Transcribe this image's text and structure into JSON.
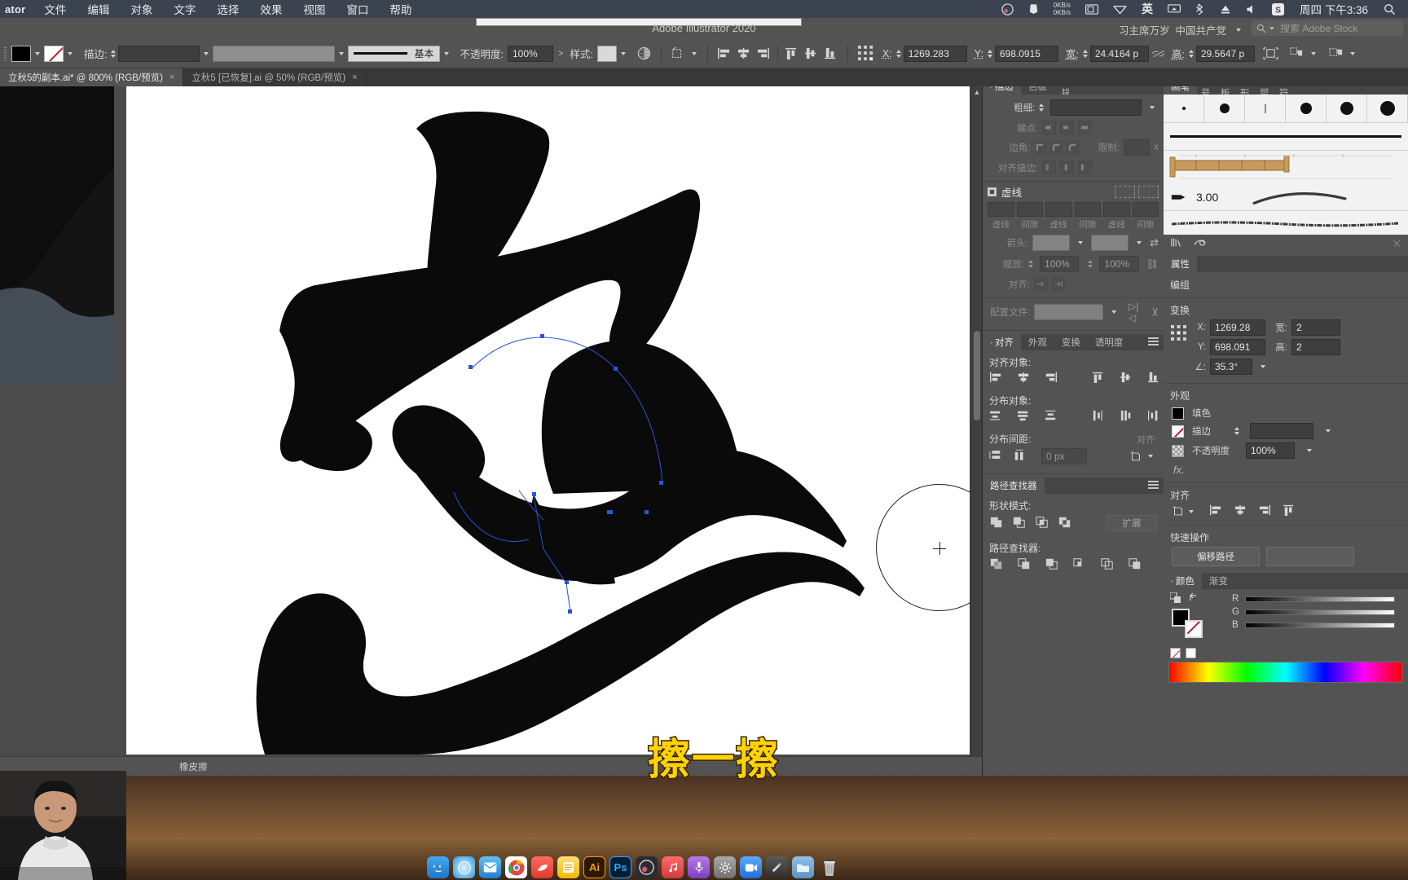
{
  "os_menubar": {
    "app_name": "ator",
    "menus": [
      "文件",
      "编辑",
      "对象",
      "文字",
      "选择",
      "效果",
      "视图",
      "窗口",
      "帮助"
    ],
    "status_icons": [
      "obs-icon",
      "dropbox-icon",
      "network-speed-icon",
      "display-icon",
      "wifi-icon",
      "input-method-icon",
      "airplay-icon",
      "bluetooth-icon",
      "eject-icon",
      "volume-icon",
      "sogou-icon"
    ],
    "network_speed_up": "0KB/s",
    "network_speed_down": "0KB/s",
    "input_method": "英",
    "sogou_label": "S",
    "time": "周四 下午3:36",
    "search_icon": "search-icon"
  },
  "app_title": {
    "title": "Adobe Illustrator 2020",
    "workspace_left": "习主席万岁",
    "workspace_right": "中国共产党",
    "stock_placeholder": "搜索 Adobe Stock"
  },
  "control_bar": {
    "fill_color": "#000000",
    "stroke_label": "描边:",
    "stroke_weight_value": "",
    "stroke_profile": "",
    "brush_def_label": "基本",
    "opacity_label": "不透明度:",
    "opacity_value": "100%",
    "style_label": "样式:",
    "x_label": "X:",
    "x_value": "1269.283",
    "y_label": "Y:",
    "y_value": "698.0915",
    "w_label": "宽:",
    "w_value": "24.4164 p",
    "h_label": "高:",
    "h_value": "29.5647 p",
    "align_icons": [
      "align-left-icon",
      "align-center-h-icon",
      "align-right-icon",
      "align-top-icon",
      "align-center-v-icon",
      "align-bottom-icon"
    ],
    "transform_icons": [
      "reference-point-icon",
      "constrain-proportions-icon",
      "transform-again-icon",
      "select-similar-icon",
      "recolor-artwork-icon"
    ]
  },
  "tabs": [
    {
      "label": "立秋5的副本.ai* @ 800% (RGB/预览)",
      "active": true,
      "close": "×"
    },
    {
      "label": "立秋5 [已恢复].ai @ 50% (RGB/预览)",
      "active": false,
      "close": "×"
    }
  ],
  "status_bar": {
    "tool_name": "橡皮擦",
    "page_nav_left": "◀",
    "page_nav_right": "▶"
  },
  "subtitle": "擦一擦",
  "panel_a": {
    "stroke_panel": {
      "tabs": [
        "描边",
        "色板",
        "图像描摹"
      ],
      "active_tab": "描边",
      "menu_icon": "panel-menu-icon",
      "weight_label": "粗细:",
      "weight_value": "",
      "cap_label": "端点:",
      "corner_label": "边角:",
      "limit_label": "限制:",
      "limit_value": "",
      "limit_unit": "x",
      "align_stroke_label": "对齐描边:",
      "dashed_label": "虚线",
      "dash_fields": [
        "虚线",
        "间隙",
        "虚线",
        "间隙",
        "虚线",
        "间隙"
      ],
      "arrow_label": "箭头:",
      "scale_label": "缩放:",
      "scale_value_1": "100%",
      "scale_value_2": "100%",
      "align_label": "对齐:",
      "profile_label": "配置文件:"
    },
    "align_panel": {
      "tabs": [
        "对齐",
        "外观",
        "变换",
        "透明度"
      ],
      "active_tab": "对齐",
      "align_objects_label": "对齐对象:",
      "distribute_objects_label": "分布对象:",
      "distribute_spacing_label": "分布间距:",
      "spacing_value": "0 px",
      "align_to_label": "对齐:"
    },
    "pathfinder_panel": {
      "title": "路径查找器",
      "shape_modes_label": "形状模式:",
      "expand_label": "扩展",
      "pathfinders_label": "路径查找器:"
    }
  },
  "panel_b": {
    "brushes_panel": {
      "tabs": [
        "画笔",
        "符号",
        "画板",
        "图形",
        "图层",
        "字符"
      ],
      "active_tab": "画笔",
      "brush_size": "3.00",
      "footer_icons": [
        "brush-libraries-icon",
        "libraries-icon",
        "delete-brush-icon"
      ]
    },
    "properties_panel": {
      "title": "属性",
      "selection_label": "编组",
      "transform_title": "变换",
      "x_label": "X:",
      "x_value": "1269.28",
      "y_label": "Y:",
      "y_value": "698.091",
      "w_label": "宽:",
      "w_value": "2",
      "h_label": "高:",
      "h_value": "2",
      "angle_label": "∠:",
      "angle_value": "35.3°",
      "appearance_title": "外观",
      "fill_label": "填色",
      "stroke_label": "描边",
      "opacity_label": "不透明度",
      "opacity_value": "100%",
      "fx_label": "fx.",
      "align_title": "对齐",
      "quick_actions_title": "快速操作",
      "offset_path_label": "偏移路径"
    },
    "color_panel": {
      "tabs": [
        "颜色",
        "渐变"
      ],
      "active_tab": "颜色",
      "channels": [
        "R",
        "G",
        "B"
      ]
    }
  },
  "dock": {
    "apps": [
      {
        "name": "finder-icon",
        "label": "",
        "color": "#2a8ce0"
      },
      {
        "name": "safari-icon",
        "label": "",
        "color": "#1ea5d8"
      },
      {
        "name": "mail-icon",
        "label": "",
        "color": "#2e9ae8"
      },
      {
        "name": "chrome-icon",
        "label": "",
        "color": "#e8453c"
      },
      {
        "name": "feishu-icon",
        "label": "",
        "color": "#f24a4a"
      },
      {
        "name": "notes-icon",
        "label": "",
        "color": "#f5c542"
      },
      {
        "name": "illustrator-icon",
        "label": "Ai",
        "color": "#ff9a00"
      },
      {
        "name": "photoshop-icon",
        "label": "Ps",
        "color": "#31a8ff"
      },
      {
        "name": "obs-icon",
        "label": "",
        "color": "#3b3b3b"
      },
      {
        "name": "music-icon",
        "label": "",
        "color": "#c94f4f"
      },
      {
        "name": "podcast-icon",
        "label": "",
        "color": "#8e55d0"
      },
      {
        "name": "settings-icon",
        "label": "",
        "color": "#7a7a7a"
      },
      {
        "name": "zoom-icon",
        "label": "",
        "color": "#2d8cff"
      },
      {
        "name": "editor-icon",
        "label": "",
        "color": "#4a4a4a"
      },
      {
        "name": "folder-icon",
        "label": "",
        "color": "#6da4d8"
      },
      {
        "name": "trash-icon",
        "label": "",
        "color": "#9c9c9c"
      }
    ]
  }
}
